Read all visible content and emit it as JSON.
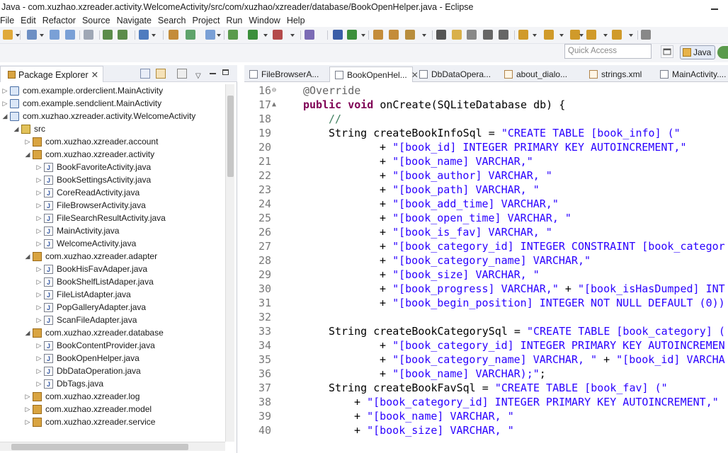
{
  "window": {
    "title": "Java - com.xuzhao.xzreader.activity.WelcomeActivity/src/com/xuzhao/xzreader/database/BookOpenHelper.java - Eclipse"
  },
  "menu": [
    "File",
    "Edit",
    "Refactor",
    "Source",
    "Navigate",
    "Search",
    "Project",
    "Run",
    "Window",
    "Help"
  ],
  "quick_access": {
    "placeholder": "Quick Access"
  },
  "perspective": {
    "active": "Java"
  },
  "package_explorer": {
    "tab_label": "Package Explorer",
    "items": [
      {
        "label": "com.example.orderclient.MainActivity",
        "type": "project",
        "depth": 0,
        "expanded": false
      },
      {
        "label": "com.example.sendclient.MainActivity",
        "type": "project",
        "depth": 0,
        "expanded": false
      },
      {
        "label": "com.xuzhao.xzreader.activity.WelcomeActivity",
        "type": "project",
        "depth": 0,
        "expanded": true
      },
      {
        "label": "src",
        "type": "src",
        "depth": 1,
        "expanded": true
      },
      {
        "label": "com.xuzhao.xzreader.account",
        "type": "package",
        "depth": 2,
        "expanded": false
      },
      {
        "label": "com.xuzhao.xzreader.activity",
        "type": "package",
        "depth": 2,
        "expanded": true
      },
      {
        "label": "BookFavoriteActivity.java",
        "type": "java",
        "depth": 3,
        "expanded": false
      },
      {
        "label": "BookSettingsActivity.java",
        "type": "java",
        "depth": 3,
        "expanded": false
      },
      {
        "label": "CoreReadActivity.java",
        "type": "java",
        "depth": 3,
        "expanded": false
      },
      {
        "label": "FileBrowserActivity.java",
        "type": "java",
        "depth": 3,
        "expanded": false
      },
      {
        "label": "FileSearchResultActivity.java",
        "type": "java",
        "depth": 3,
        "expanded": false
      },
      {
        "label": "MainActivity.java",
        "type": "java",
        "depth": 3,
        "expanded": false
      },
      {
        "label": "WelcomeActivity.java",
        "type": "java",
        "depth": 3,
        "expanded": false
      },
      {
        "label": "com.xuzhao.xzreader.adapter",
        "type": "package",
        "depth": 2,
        "expanded": true
      },
      {
        "label": "BookHisFavAdaper.java",
        "type": "java",
        "depth": 3,
        "expanded": false
      },
      {
        "label": "BookShelfListAdaper.java",
        "type": "java",
        "depth": 3,
        "expanded": false
      },
      {
        "label": "FileListAdapter.java",
        "type": "java",
        "depth": 3,
        "expanded": false
      },
      {
        "label": "PopGalleryAdapter.java",
        "type": "java",
        "depth": 3,
        "expanded": false
      },
      {
        "label": "ScanFileAdapter.java",
        "type": "java",
        "depth": 3,
        "expanded": false
      },
      {
        "label": "com.xuzhao.xzreader.database",
        "type": "package",
        "depth": 2,
        "expanded": true
      },
      {
        "label": "BookContentProvider.java",
        "type": "java",
        "depth": 3,
        "expanded": false
      },
      {
        "label": "BookOpenHelper.java",
        "type": "java",
        "depth": 3,
        "expanded": false
      },
      {
        "label": "DbDataOperation.java",
        "type": "java",
        "depth": 3,
        "expanded": false
      },
      {
        "label": "DbTags.java",
        "type": "java",
        "depth": 3,
        "expanded": false
      },
      {
        "label": "com.xuzhao.xzreader.log",
        "type": "package",
        "depth": 2,
        "expanded": false
      },
      {
        "label": "com.xuzhao.xzreader.model",
        "type": "package",
        "depth": 2,
        "expanded": false
      },
      {
        "label": "com.xuzhao.xzreader.service",
        "type": "package",
        "depth": 2,
        "expanded": false
      }
    ]
  },
  "editor_tabs": [
    {
      "label": "FileBrowserA...",
      "kind": "java",
      "active": false
    },
    {
      "label": "BookOpenHel...",
      "kind": "java",
      "active": true
    },
    {
      "label": "DbDataOpera...",
      "kind": "java",
      "active": false
    },
    {
      "label": "about_dialo...",
      "kind": "xml",
      "active": false
    },
    {
      "label": "strings.xml",
      "kind": "xml",
      "active": false
    },
    {
      "label": "MainActivity....",
      "kind": "java",
      "active": false
    }
  ],
  "code": [
    {
      "n": "16",
      "fold": "minus",
      "indent": 0,
      "tokens": [
        [
          "ann",
          "@Override"
        ]
      ]
    },
    {
      "n": "17",
      "fold": "up",
      "indent": 0,
      "tokens": [
        [
          "kw",
          "public"
        ],
        [
          "",
          " "
        ],
        [
          "kw",
          "void"
        ],
        [
          "",
          " onCreate(SQLiteDatabase db) {"
        ]
      ]
    },
    {
      "n": "18",
      "fold": "",
      "indent": 1,
      "tokens": [
        [
          "cmt",
          "//"
        ]
      ]
    },
    {
      "n": "19",
      "fold": "",
      "indent": 1,
      "tokens": [
        [
          "",
          "String createBookInfoSql = "
        ],
        [
          "str",
          "\"CREATE TABLE [book_info] (\""
        ]
      ]
    },
    {
      "n": "20",
      "fold": "",
      "indent": 3,
      "tokens": [
        [
          "",
          "+ "
        ],
        [
          "str",
          "\"[book_id] INTEGER PRIMARY KEY AUTOINCREMENT,\""
        ]
      ]
    },
    {
      "n": "21",
      "fold": "",
      "indent": 3,
      "tokens": [
        [
          "",
          "+ "
        ],
        [
          "str",
          "\"[book_name] VARCHAR,\""
        ]
      ]
    },
    {
      "n": "22",
      "fold": "",
      "indent": 3,
      "tokens": [
        [
          "",
          "+ "
        ],
        [
          "str",
          "\"[book_author] VARCHAR, \""
        ]
      ]
    },
    {
      "n": "23",
      "fold": "",
      "indent": 3,
      "tokens": [
        [
          "",
          "+ "
        ],
        [
          "str",
          "\"[book_path] VARCHAR, \""
        ]
      ]
    },
    {
      "n": "24",
      "fold": "",
      "indent": 3,
      "tokens": [
        [
          "",
          "+ "
        ],
        [
          "str",
          "\"[book_add_time] VARCHAR,\""
        ]
      ]
    },
    {
      "n": "25",
      "fold": "",
      "indent": 3,
      "tokens": [
        [
          "",
          "+ "
        ],
        [
          "str",
          "\"[book_open_time] VARCHAR, \""
        ]
      ]
    },
    {
      "n": "26",
      "fold": "",
      "indent": 3,
      "tokens": [
        [
          "",
          "+ "
        ],
        [
          "str",
          "\"[book_is_fav] VARCHAR, \""
        ]
      ]
    },
    {
      "n": "27",
      "fold": "",
      "indent": 3,
      "tokens": [
        [
          "",
          "+ "
        ],
        [
          "str",
          "\"[book_category_id] INTEGER CONSTRAINT [book_categor"
        ]
      ]
    },
    {
      "n": "28",
      "fold": "",
      "indent": 3,
      "tokens": [
        [
          "",
          "+ "
        ],
        [
          "str",
          "\"[book_category_name] VARCHAR,\""
        ]
      ]
    },
    {
      "n": "29",
      "fold": "",
      "indent": 3,
      "tokens": [
        [
          "",
          "+ "
        ],
        [
          "str",
          "\"[book_size] VARCHAR, \""
        ]
      ]
    },
    {
      "n": "30",
      "fold": "",
      "indent": 3,
      "tokens": [
        [
          "",
          "+ "
        ],
        [
          "str",
          "\"[book_progress] VARCHAR,\""
        ],
        [
          "",
          " + "
        ],
        [
          "str",
          "\"[book_isHasDumped] INT"
        ]
      ]
    },
    {
      "n": "31",
      "fold": "",
      "indent": 3,
      "tokens": [
        [
          "",
          "+ "
        ],
        [
          "str",
          "\"[book_begin_position] INTEGER NOT NULL DEFAULT (0))"
        ]
      ]
    },
    {
      "n": "32",
      "fold": "",
      "indent": 0,
      "tokens": []
    },
    {
      "n": "33",
      "fold": "",
      "indent": 1,
      "tokens": [
        [
          "",
          "String createBookCategorySql = "
        ],
        [
          "str",
          "\"CREATE TABLE [book_category] ("
        ]
      ]
    },
    {
      "n": "34",
      "fold": "",
      "indent": 3,
      "tokens": [
        [
          "",
          "+ "
        ],
        [
          "str",
          "\"[book_category_id] INTEGER PRIMARY KEY AUTOINCREMEN"
        ]
      ]
    },
    {
      "n": "35",
      "fold": "",
      "indent": 3,
      "tokens": [
        [
          "",
          "+ "
        ],
        [
          "str",
          "\"[book_category_name] VARCHAR, \""
        ],
        [
          "",
          " + "
        ],
        [
          "str",
          "\"[book_id] VARCHA"
        ]
      ]
    },
    {
      "n": "36",
      "fold": "",
      "indent": 3,
      "tokens": [
        [
          "",
          "+ "
        ],
        [
          "str",
          "\"[book_name] VARCHAR);\""
        ],
        [
          "",
          ";"
        ]
      ]
    },
    {
      "n": "37",
      "fold": "",
      "indent": 1,
      "tokens": [
        [
          "",
          "String createBookFavSql = "
        ],
        [
          "str",
          "\"CREATE TABLE [book_fav] (\""
        ]
      ]
    },
    {
      "n": "38",
      "fold": "",
      "indent": 2,
      "tokens": [
        [
          "",
          "+ "
        ],
        [
          "str",
          "\"[book_category_id] INTEGER PRIMARY KEY AUTOINCREMENT,\""
        ]
      ]
    },
    {
      "n": "39",
      "fold": "",
      "indent": 2,
      "tokens": [
        [
          "",
          "+ "
        ],
        [
          "str",
          "\"[book_name] VARCHAR, \""
        ]
      ]
    },
    {
      "n": "40",
      "fold": "",
      "indent": 2,
      "tokens": [
        [
          "",
          "+ "
        ],
        [
          "str",
          "\"[book_size] VARCHAR, \""
        ]
      ]
    }
  ],
  "colors": {
    "keyword": "#7f0055",
    "string": "#2a00ff",
    "comment": "#3f7f5f",
    "annotation": "#646464",
    "line_number": "#787878"
  }
}
